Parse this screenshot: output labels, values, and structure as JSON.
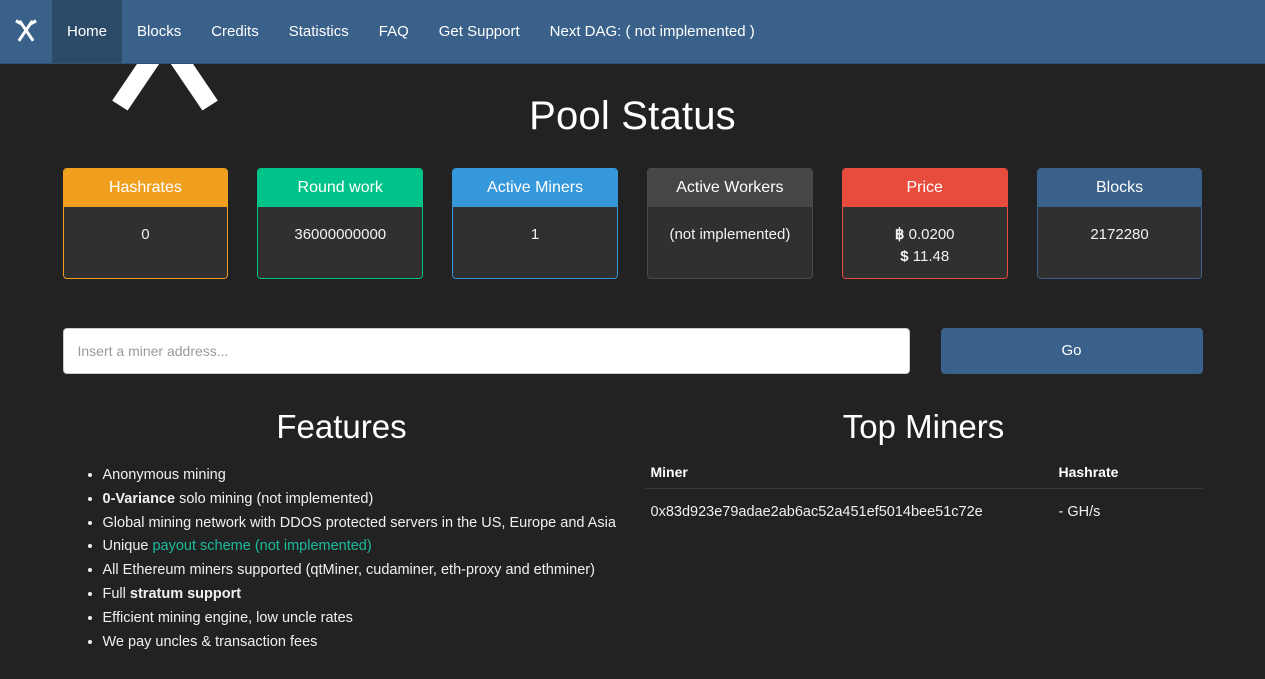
{
  "navbar": {
    "brand_icon": "crossed-hammers-logo",
    "items": [
      {
        "label": "Home",
        "active": true
      },
      {
        "label": "Blocks",
        "active": false
      },
      {
        "label": "Credits",
        "active": false
      },
      {
        "label": "Statistics",
        "active": false
      },
      {
        "label": "FAQ",
        "active": false
      },
      {
        "label": "Get Support",
        "active": false
      },
      {
        "label": "Next DAG: ( not implemented )",
        "active": false
      }
    ],
    "bg_color": "#3a6189",
    "active_bg_color": "#2b4a68"
  },
  "hero": {
    "logo_icon": "crossed-hammers-watermark"
  },
  "page": {
    "title": "Pool Status",
    "background_color": "#222222"
  },
  "stats": [
    {
      "label": "Hashrates",
      "value": "0",
      "accent": "#f0a01e"
    },
    {
      "label": "Round work",
      "value": "36000000000",
      "accent": "#00c389"
    },
    {
      "label": "Active Miners",
      "value": "1",
      "accent": "#3498db"
    },
    {
      "label": "Active Workers",
      "value": "(not implemented)",
      "accent": "#464646"
    },
    {
      "label": "Price",
      "btc_symbol": "฿",
      "btc_value": "0.0200",
      "usd_symbol": "$",
      "usd_value": "11.48",
      "accent": "#e74c3c"
    },
    {
      "label": "Blocks",
      "value": "2172280",
      "accent": "#3a6189"
    }
  ],
  "search": {
    "placeholder": "Insert a miner address...",
    "value": "",
    "go_label": "Go"
  },
  "features": {
    "title": "Features",
    "items": [
      {
        "text": "Anonymous mining"
      },
      {
        "bold_prefix": "0-Variance",
        "text": " solo mining (not implemented)"
      },
      {
        "text": "Global mining network with DDOS protected servers in the US, Europe and Asia"
      },
      {
        "text": "Unique ",
        "link": "payout scheme (not implemented)"
      },
      {
        "text": "All Ethereum miners supported (qtMiner, cudaminer, eth-proxy and ethminer)"
      },
      {
        "text": "Full ",
        "bold_suffix": "stratum support"
      },
      {
        "text": "Efficient mining engine, low uncle rates"
      },
      {
        "text": "We pay uncles & transaction fees"
      }
    ]
  },
  "top_miners": {
    "title": "Top Miners",
    "columns": [
      "Miner",
      "Hashrate"
    ],
    "rows": [
      {
        "miner": "0x83d923e79adae2ab6ac52a451ef5014bee51c72e",
        "hashrate": "- GH/s"
      }
    ]
  }
}
